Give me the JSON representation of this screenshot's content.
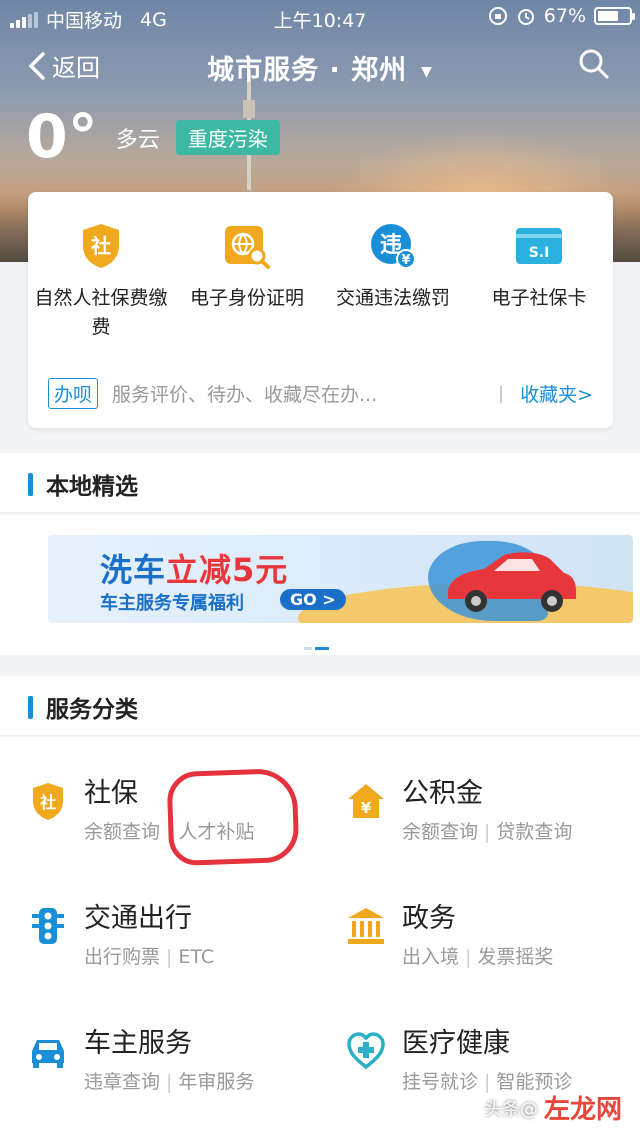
{
  "status_bar": {
    "carrier": "中国移动",
    "network": "4G",
    "time": "上午10:47",
    "battery": "67%",
    "battery_level": 0.67
  },
  "nav": {
    "back_label": "返回",
    "title": "城市服务 · 郑州",
    "caret": "▼"
  },
  "weather": {
    "temp": "0°",
    "condition": "多云",
    "aqi": "重度污染"
  },
  "quick_services": [
    {
      "label": "自然人社保费缴费",
      "icon": "social-security-shield-icon",
      "color": "#f0a81c"
    },
    {
      "label": "电子身份证明",
      "icon": "id-globe-search-icon",
      "color": "#f0a81c"
    },
    {
      "label": "交通违法缴罚",
      "icon": "traffic-violation-icon",
      "color": "#1a8fd8"
    },
    {
      "label": "电子社保卡",
      "icon": "si-card-icon",
      "color": "#2bb0e0"
    }
  ],
  "todo": {
    "tag": "办呗",
    "hint": "服务评价、待办、收藏尽在办...",
    "separator": "|",
    "favorites": "收藏夹>"
  },
  "local_section": {
    "title": "本地精选"
  },
  "banner": {
    "title_a": "洗车",
    "title_b": "立减5元",
    "subtitle": "车主服务专属福利",
    "go": "GO >"
  },
  "category_section": {
    "title": "服务分类"
  },
  "services": [
    {
      "name": "社保",
      "subs": [
        "余额查询",
        "人才补贴"
      ],
      "icon": "social-security-shield-icon",
      "color": "#f0a81c"
    },
    {
      "name": "公积金",
      "subs": [
        "余额查询",
        "贷款查询"
      ],
      "icon": "housing-fund-icon",
      "color": "#f0a81c"
    },
    {
      "name": "交通出行",
      "subs": [
        "出行购票",
        "ETC"
      ],
      "icon": "traffic-light-icon",
      "color": "#1a8fd8"
    },
    {
      "name": "政务",
      "subs": [
        "出入境",
        "发票摇奖"
      ],
      "icon": "government-building-icon",
      "color": "#f0a81c"
    },
    {
      "name": "车主服务",
      "subs": [
        "违章查询",
        "年审服务"
      ],
      "icon": "car-icon",
      "color": "#1a8fd8"
    },
    {
      "name": "医疗健康",
      "subs": [
        "挂号就诊",
        "智能预诊"
      ],
      "icon": "medical-heart-icon",
      "color": "#2bb0c8"
    }
  ],
  "watermark": {
    "prefix": "头条@",
    "logo": "左龙网"
  }
}
